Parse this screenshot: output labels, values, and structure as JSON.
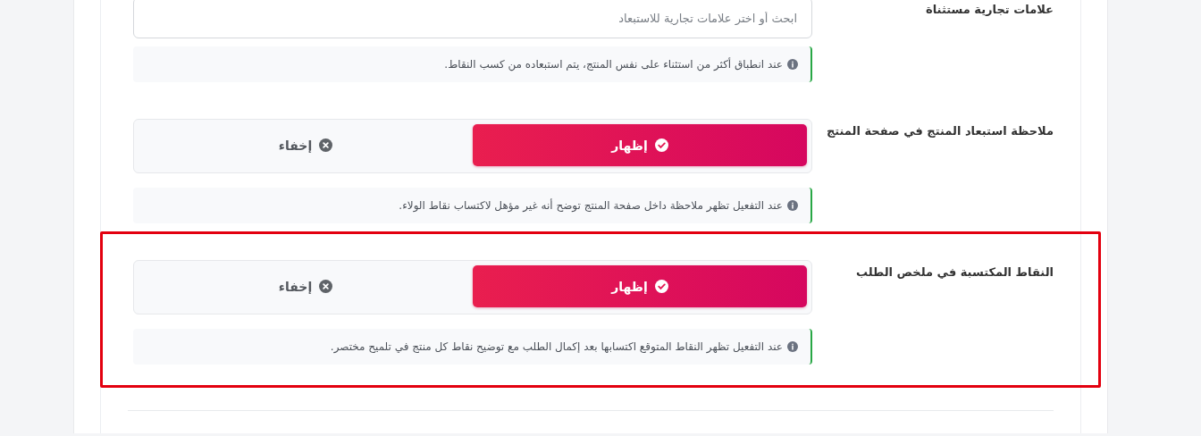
{
  "settings": [
    {
      "label": "علامات تجارية مستثناة",
      "kind": "search",
      "highlighted": false,
      "placeholder": "ابحث أو اختر علامات تجارية للاستبعاد",
      "hint": "عند انطباق أكثر من استثناء على نفس المنتج، يتم استبعاده من كسب النقاط."
    },
    {
      "label": "ملاحظة استبعاد المنتج في صفحة المنتج",
      "kind": "toggle",
      "highlighted": false,
      "options": [
        {
          "label": "إظهار",
          "kind": "show",
          "selected": true
        },
        {
          "label": "إخفاء",
          "kind": "hide",
          "selected": false
        }
      ],
      "hint": "عند التفعيل تظهر ملاحظة داخل صفحة المنتج توضح أنه غير مؤهل لاكتساب نقاط الولاء."
    },
    {
      "label": "النقاط المكتسبة في ملخص الطلب",
      "kind": "toggle",
      "highlighted": true,
      "options": [
        {
          "label": "إظهار",
          "kind": "show",
          "selected": true
        },
        {
          "label": "إخفاء",
          "kind": "hide",
          "selected": false
        }
      ],
      "hint": "عند التفعيل تظهر النقاط المتوقع اكتسابها بعد إكمال الطلب مع توضيح نقاط كل منتج في تلميح مختصر."
    }
  ]
}
